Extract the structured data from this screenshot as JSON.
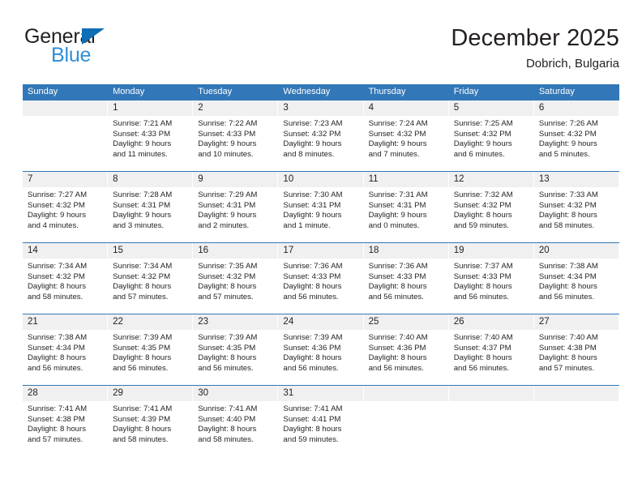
{
  "brand": {
    "name_top": "General",
    "name_bottom": "Blue",
    "triangle_color": "#0d6db5",
    "top_color": "#231f20",
    "bottom_color": "#2e8fd6"
  },
  "header": {
    "title": "December 2025",
    "location": "Dobrich, Bulgaria",
    "accent_color": "#3277b7",
    "daynum_band_color": "#f0f0f0"
  },
  "weekdays": [
    "Sunday",
    "Monday",
    "Tuesday",
    "Wednesday",
    "Thursday",
    "Friday",
    "Saturday"
  ],
  "weeks": [
    [
      {
        "day": "",
        "lines": []
      },
      {
        "day": "1",
        "lines": [
          "Sunrise: 7:21 AM",
          "Sunset: 4:33 PM",
          "Daylight: 9 hours",
          "and 11 minutes."
        ]
      },
      {
        "day": "2",
        "lines": [
          "Sunrise: 7:22 AM",
          "Sunset: 4:33 PM",
          "Daylight: 9 hours",
          "and 10 minutes."
        ]
      },
      {
        "day": "3",
        "lines": [
          "Sunrise: 7:23 AM",
          "Sunset: 4:32 PM",
          "Daylight: 9 hours",
          "and 8 minutes."
        ]
      },
      {
        "day": "4",
        "lines": [
          "Sunrise: 7:24 AM",
          "Sunset: 4:32 PM",
          "Daylight: 9 hours",
          "and 7 minutes."
        ]
      },
      {
        "day": "5",
        "lines": [
          "Sunrise: 7:25 AM",
          "Sunset: 4:32 PM",
          "Daylight: 9 hours",
          "and 6 minutes."
        ]
      },
      {
        "day": "6",
        "lines": [
          "Sunrise: 7:26 AM",
          "Sunset: 4:32 PM",
          "Daylight: 9 hours",
          "and 5 minutes."
        ]
      }
    ],
    [
      {
        "day": "7",
        "lines": [
          "Sunrise: 7:27 AM",
          "Sunset: 4:32 PM",
          "Daylight: 9 hours",
          "and 4 minutes."
        ]
      },
      {
        "day": "8",
        "lines": [
          "Sunrise: 7:28 AM",
          "Sunset: 4:31 PM",
          "Daylight: 9 hours",
          "and 3 minutes."
        ]
      },
      {
        "day": "9",
        "lines": [
          "Sunrise: 7:29 AM",
          "Sunset: 4:31 PM",
          "Daylight: 9 hours",
          "and 2 minutes."
        ]
      },
      {
        "day": "10",
        "lines": [
          "Sunrise: 7:30 AM",
          "Sunset: 4:31 PM",
          "Daylight: 9 hours",
          "and 1 minute."
        ]
      },
      {
        "day": "11",
        "lines": [
          "Sunrise: 7:31 AM",
          "Sunset: 4:31 PM",
          "Daylight: 9 hours",
          "and 0 minutes."
        ]
      },
      {
        "day": "12",
        "lines": [
          "Sunrise: 7:32 AM",
          "Sunset: 4:32 PM",
          "Daylight: 8 hours",
          "and 59 minutes."
        ]
      },
      {
        "day": "13",
        "lines": [
          "Sunrise: 7:33 AM",
          "Sunset: 4:32 PM",
          "Daylight: 8 hours",
          "and 58 minutes."
        ]
      }
    ],
    [
      {
        "day": "14",
        "lines": [
          "Sunrise: 7:34 AM",
          "Sunset: 4:32 PM",
          "Daylight: 8 hours",
          "and 58 minutes."
        ]
      },
      {
        "day": "15",
        "lines": [
          "Sunrise: 7:34 AM",
          "Sunset: 4:32 PM",
          "Daylight: 8 hours",
          "and 57 minutes."
        ]
      },
      {
        "day": "16",
        "lines": [
          "Sunrise: 7:35 AM",
          "Sunset: 4:32 PM",
          "Daylight: 8 hours",
          "and 57 minutes."
        ]
      },
      {
        "day": "17",
        "lines": [
          "Sunrise: 7:36 AM",
          "Sunset: 4:33 PM",
          "Daylight: 8 hours",
          "and 56 minutes."
        ]
      },
      {
        "day": "18",
        "lines": [
          "Sunrise: 7:36 AM",
          "Sunset: 4:33 PM",
          "Daylight: 8 hours",
          "and 56 minutes."
        ]
      },
      {
        "day": "19",
        "lines": [
          "Sunrise: 7:37 AM",
          "Sunset: 4:33 PM",
          "Daylight: 8 hours",
          "and 56 minutes."
        ]
      },
      {
        "day": "20",
        "lines": [
          "Sunrise: 7:38 AM",
          "Sunset: 4:34 PM",
          "Daylight: 8 hours",
          "and 56 minutes."
        ]
      }
    ],
    [
      {
        "day": "21",
        "lines": [
          "Sunrise: 7:38 AM",
          "Sunset: 4:34 PM",
          "Daylight: 8 hours",
          "and 56 minutes."
        ]
      },
      {
        "day": "22",
        "lines": [
          "Sunrise: 7:39 AM",
          "Sunset: 4:35 PM",
          "Daylight: 8 hours",
          "and 56 minutes."
        ]
      },
      {
        "day": "23",
        "lines": [
          "Sunrise: 7:39 AM",
          "Sunset: 4:35 PM",
          "Daylight: 8 hours",
          "and 56 minutes."
        ]
      },
      {
        "day": "24",
        "lines": [
          "Sunrise: 7:39 AM",
          "Sunset: 4:36 PM",
          "Daylight: 8 hours",
          "and 56 minutes."
        ]
      },
      {
        "day": "25",
        "lines": [
          "Sunrise: 7:40 AM",
          "Sunset: 4:36 PM",
          "Daylight: 8 hours",
          "and 56 minutes."
        ]
      },
      {
        "day": "26",
        "lines": [
          "Sunrise: 7:40 AM",
          "Sunset: 4:37 PM",
          "Daylight: 8 hours",
          "and 56 minutes."
        ]
      },
      {
        "day": "27",
        "lines": [
          "Sunrise: 7:40 AM",
          "Sunset: 4:38 PM",
          "Daylight: 8 hours",
          "and 57 minutes."
        ]
      }
    ],
    [
      {
        "day": "28",
        "lines": [
          "Sunrise: 7:41 AM",
          "Sunset: 4:38 PM",
          "Daylight: 8 hours",
          "and 57 minutes."
        ]
      },
      {
        "day": "29",
        "lines": [
          "Sunrise: 7:41 AM",
          "Sunset: 4:39 PM",
          "Daylight: 8 hours",
          "and 58 minutes."
        ]
      },
      {
        "day": "30",
        "lines": [
          "Sunrise: 7:41 AM",
          "Sunset: 4:40 PM",
          "Daylight: 8 hours",
          "and 58 minutes."
        ]
      },
      {
        "day": "31",
        "lines": [
          "Sunrise: 7:41 AM",
          "Sunset: 4:41 PM",
          "Daylight: 8 hours",
          "and 59 minutes."
        ]
      },
      {
        "day": "",
        "lines": []
      },
      {
        "day": "",
        "lines": []
      },
      {
        "day": "",
        "lines": []
      }
    ]
  ]
}
